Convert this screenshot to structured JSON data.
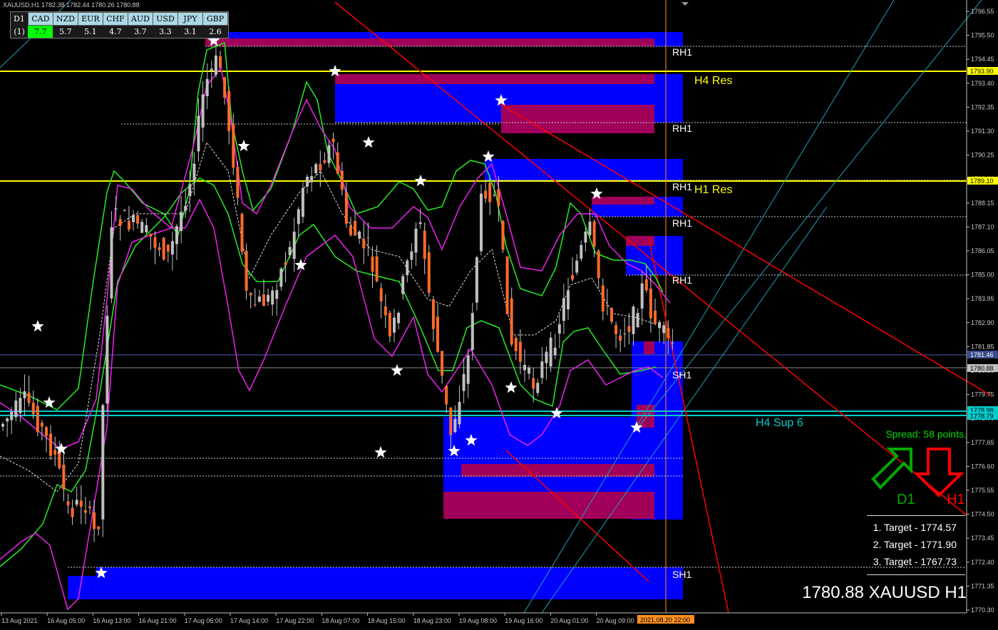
{
  "window": {
    "title": "XAUUSD,H1  1782.38 1782.44 1780.26 1780.88"
  },
  "strength_panel": {
    "timeframe": "D1",
    "row_label": "(1)",
    "currencies": [
      "CAD",
      "NZD",
      "EUR",
      "CHF",
      "AUD",
      "USD",
      "JPY",
      "GBP"
    ],
    "values": [
      "7.7",
      "5.7",
      "5.1",
      "4.7",
      "3.7",
      "3.3",
      "3.1",
      "2.6"
    ],
    "highlight_color": "#00ff00"
  },
  "price_axis": {
    "ticks": [
      "1796.55",
      "1795.50",
      "1794.45",
      "1793.40",
      "1792.35",
      "1791.30",
      "1790.25",
      "1789.20",
      "1788.15",
      "1787.10",
      "1786.05",
      "1785.00",
      "1783.95",
      "1782.90",
      "1781.85",
      "1780.80",
      "1779.75",
      "1778.70",
      "1777.65",
      "1776.60",
      "1775.55",
      "1774.50",
      "1773.45",
      "1772.40",
      "1771.35",
      "1770.30"
    ],
    "tags": [
      {
        "text": "1793.90",
        "bg": "#ffff00",
        "fg": "#000000"
      },
      {
        "text": "1789.10",
        "bg": "#ffff00",
        "fg": "#000000"
      },
      {
        "text": "1781.46",
        "bg": "#3a4a8a",
        "fg": "#ffffff"
      },
      {
        "text": "1780.88",
        "bg": "#c0c0c0",
        "fg": "#000000"
      },
      {
        "text": "1778.98",
        "bg": "#00cccc",
        "fg": "#000000"
      },
      {
        "text": "1778.79",
        "bg": "#00cccc",
        "fg": "#000000"
      }
    ]
  },
  "time_axis": {
    "labels": [
      "13 Aug 2021",
      "16 Aug 05:00",
      "16 Aug 13:00",
      "16 Aug 21:00",
      "17 Aug 06:00",
      "17 Aug 14:00",
      "17 Aug 22:00",
      "18 Aug 07:00",
      "18 Aug 15:00",
      "18 Aug 23:00",
      "19 Aug 08:00",
      "19 Aug 16:00",
      "20 Aug 01:00",
      "20 Aug 09:00"
    ],
    "current_tag": "2021.08.20 22:00"
  },
  "levels": {
    "h4_res": "H4 Res",
    "h1_res": "H1 Res",
    "h4_sup": "H4 Sup 6",
    "rh1": "RH1",
    "sh1": "SH1"
  },
  "info": {
    "spread": "Spread: 58 points.",
    "d1_label": "D1",
    "h1_label": "H1",
    "targets": [
      "1. Target - 1774.57",
      "2. Target - 1771.90",
      "3. Target - 1767.73"
    ],
    "summary": "1780.88 XAUUSD H1"
  },
  "colors": {
    "bull": "#c0c0c0",
    "bear": "#ff6a2a",
    "zone_blue": "#0000ff",
    "zone_red": "#a0005a",
    "yellow": "#ffff00",
    "cyan": "#00cccc",
    "green": "#22ee22",
    "magenta": "#ee22ee",
    "trend": "#ff0000"
  }
}
